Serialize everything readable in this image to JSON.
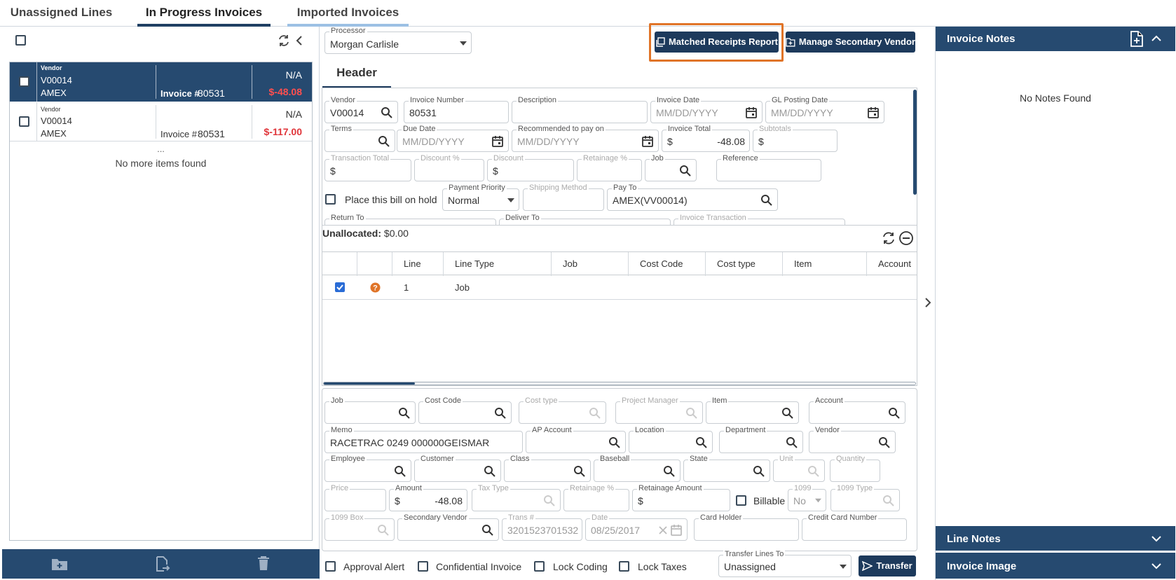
{
  "tabs": [
    {
      "label": "Unassigned Lines"
    },
    {
      "label": "In Progress Invoices"
    },
    {
      "label": "Imported Invoices"
    }
  ],
  "left_list": {
    "items": [
      {
        "vendor_label": "Vendor",
        "vendor_code": "V00014",
        "vendor_name": "AMEX",
        "invoice_label": "Invoice #",
        "invoice_number": "80531",
        "status": "N/A",
        "amount": "$-48.08",
        "selected": true
      },
      {
        "vendor_label": "Vendor",
        "vendor_code": "V00014",
        "vendor_name": "AMEX",
        "invoice_label": "Invoice #",
        "invoice_number": "80531",
        "status": "N/A",
        "amount": "$-117.00",
        "selected": false
      }
    ],
    "ellipsis": "...",
    "end_message": "No more items found"
  },
  "processor": {
    "label": "Processor",
    "value": "Morgan Carlisle"
  },
  "toolbar": {
    "matched_receipts_label": "Matched Receipts Report",
    "manage_secondary_vendor_label": "Manage Secondary Vendor"
  },
  "header_tab": "Header",
  "header_fields": {
    "vendor": {
      "label": "Vendor",
      "value": "V00014"
    },
    "invoice_number": {
      "label": "Invoice Number",
      "value": "80531"
    },
    "description": {
      "label": "Description",
      "value": ""
    },
    "invoice_date": {
      "label": "Invoice Date",
      "placeholder": "MM/DD/YYYY"
    },
    "gl_posting_date": {
      "label": "GL Posting Date",
      "placeholder": "MM/DD/YYYY"
    },
    "terms": {
      "label": "Terms",
      "value": ""
    },
    "due_date": {
      "label": "Due Date",
      "placeholder": "MM/DD/YYYY"
    },
    "recommended_pay": {
      "label": "Recommended to pay on",
      "placeholder": "MM/DD/YYYY"
    },
    "invoice_total": {
      "label": "Invoice Total",
      "currency": "$",
      "value": "-48.08"
    },
    "subtotals": {
      "label": "Subtotals",
      "currency": "$"
    },
    "transaction_total": {
      "label": "Transaction Total",
      "currency": "$"
    },
    "discount_pct": {
      "label": "Discount %"
    },
    "discount": {
      "label": "Discount",
      "currency": "$"
    },
    "retainage_pct": {
      "label": "Retainage %"
    },
    "job": {
      "label": "Job"
    },
    "reference": {
      "label": "Reference"
    },
    "hold_label": "Place this bill on hold",
    "payment_priority": {
      "label": "Payment Priority",
      "value": "Normal"
    },
    "shipping_method": {
      "label": "Shipping Method"
    },
    "pay_to": {
      "label": "Pay To",
      "value": "AMEX(VV00014)"
    },
    "return_to": {
      "label": "Return To"
    },
    "deliver_to": {
      "label": "Deliver To"
    },
    "invoice_transaction": {
      "label": "Invoice Transaction"
    }
  },
  "unallocated": {
    "label": "Unallocated:",
    "value": "$0.00"
  },
  "lines_table": {
    "columns": [
      "Line",
      "Line Type",
      "Job",
      "Cost Code",
      "Cost type",
      "Item",
      "Account"
    ],
    "rows": [
      {
        "line": "1",
        "line_type": "Job",
        "checked": true
      }
    ]
  },
  "line_fields": {
    "job": {
      "label": "Job"
    },
    "cost_code": {
      "label": "Cost Code"
    },
    "cost_type": {
      "label": "Cost type"
    },
    "project_manager": {
      "label": "Project Manager"
    },
    "item": {
      "label": "Item"
    },
    "account": {
      "label": "Account"
    },
    "memo": {
      "label": "Memo",
      "value": "RACETRAC 0249 000000GEISMAR"
    },
    "ap_account": {
      "label": "AP Account"
    },
    "location": {
      "label": "Location"
    },
    "department": {
      "label": "Department"
    },
    "vendor": {
      "label": "Vendor"
    },
    "employee": {
      "label": "Employee"
    },
    "customer": {
      "label": "Customer"
    },
    "class": {
      "label": "Class"
    },
    "baseball": {
      "label": "Baseball"
    },
    "state": {
      "label": "State"
    },
    "unit": {
      "label": "Unit"
    },
    "quantity": {
      "label": "Quantity"
    },
    "price": {
      "label": "Price"
    },
    "amount": {
      "label": "Amount",
      "currency": "$",
      "value": "-48.08"
    },
    "tax_type": {
      "label": "Tax Type"
    },
    "retainage_pct": {
      "label": "Retainage %"
    },
    "retainage_amount": {
      "label": "Retainage Amount",
      "currency": "$"
    },
    "billable_label": "Billable",
    "f1099": {
      "label": "1099",
      "value": "No"
    },
    "f1099_type": {
      "label": "1099 Type"
    },
    "f1099_box": {
      "label": "1099 Box"
    },
    "secondary_vendor": {
      "label": "Secondary Vendor"
    },
    "trans_num": {
      "label": "Trans #",
      "value": "3201523701532"
    },
    "date": {
      "label": "Date",
      "value": "08/25/2017"
    },
    "card_holder": {
      "label": "Card Holder"
    },
    "credit_card_number": {
      "label": "Credit Card Number"
    }
  },
  "bottom_bar": {
    "approval_alert": "Approval Alert",
    "confidential_invoice": "Confidential Invoice",
    "lock_coding": "Lock Coding",
    "lock_taxes": "Lock Taxes",
    "transfer_lines_to": {
      "label": "Transfer Lines To",
      "value": "Unassigned"
    },
    "transfer_label": "Transfer"
  },
  "right_panel": {
    "invoice_notes": "Invoice Notes",
    "no_notes": "No Notes Found",
    "line_notes": "Line Notes",
    "invoice_image": "Invoice Image"
  },
  "colors": {
    "primary": "#1d3a5c",
    "accent_outline": "#e07428",
    "negative": "#e0353a",
    "help": "#e07428"
  }
}
